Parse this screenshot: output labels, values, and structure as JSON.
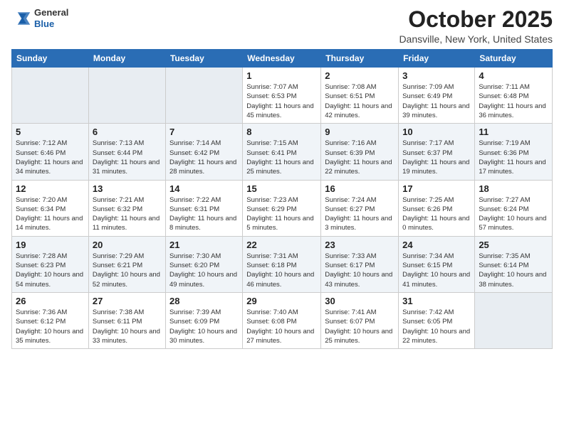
{
  "logo": {
    "general": "General",
    "blue": "Blue"
  },
  "header": {
    "title": "October 2025",
    "location": "Dansville, New York, United States"
  },
  "days_of_week": [
    "Sunday",
    "Monday",
    "Tuesday",
    "Wednesday",
    "Thursday",
    "Friday",
    "Saturday"
  ],
  "weeks": [
    [
      null,
      null,
      null,
      {
        "day": "1",
        "sunrise": "7:07 AM",
        "sunset": "6:53 PM",
        "daylight": "11 hours and 45 minutes."
      },
      {
        "day": "2",
        "sunrise": "7:08 AM",
        "sunset": "6:51 PM",
        "daylight": "11 hours and 42 minutes."
      },
      {
        "day": "3",
        "sunrise": "7:09 AM",
        "sunset": "6:49 PM",
        "daylight": "11 hours and 39 minutes."
      },
      {
        "day": "4",
        "sunrise": "7:11 AM",
        "sunset": "6:48 PM",
        "daylight": "11 hours and 36 minutes."
      }
    ],
    [
      {
        "day": "5",
        "sunrise": "7:12 AM",
        "sunset": "6:46 PM",
        "daylight": "11 hours and 34 minutes."
      },
      {
        "day": "6",
        "sunrise": "7:13 AM",
        "sunset": "6:44 PM",
        "daylight": "11 hours and 31 minutes."
      },
      {
        "day": "7",
        "sunrise": "7:14 AM",
        "sunset": "6:42 PM",
        "daylight": "11 hours and 28 minutes."
      },
      {
        "day": "8",
        "sunrise": "7:15 AM",
        "sunset": "6:41 PM",
        "daylight": "11 hours and 25 minutes."
      },
      {
        "day": "9",
        "sunrise": "7:16 AM",
        "sunset": "6:39 PM",
        "daylight": "11 hours and 22 minutes."
      },
      {
        "day": "10",
        "sunrise": "7:17 AM",
        "sunset": "6:37 PM",
        "daylight": "11 hours and 19 minutes."
      },
      {
        "day": "11",
        "sunrise": "7:19 AM",
        "sunset": "6:36 PM",
        "daylight": "11 hours and 17 minutes."
      }
    ],
    [
      {
        "day": "12",
        "sunrise": "7:20 AM",
        "sunset": "6:34 PM",
        "daylight": "11 hours and 14 minutes."
      },
      {
        "day": "13",
        "sunrise": "7:21 AM",
        "sunset": "6:32 PM",
        "daylight": "11 hours and 11 minutes."
      },
      {
        "day": "14",
        "sunrise": "7:22 AM",
        "sunset": "6:31 PM",
        "daylight": "11 hours and 8 minutes."
      },
      {
        "day": "15",
        "sunrise": "7:23 AM",
        "sunset": "6:29 PM",
        "daylight": "11 hours and 5 minutes."
      },
      {
        "day": "16",
        "sunrise": "7:24 AM",
        "sunset": "6:27 PM",
        "daylight": "11 hours and 3 minutes."
      },
      {
        "day": "17",
        "sunrise": "7:25 AM",
        "sunset": "6:26 PM",
        "daylight": "11 hours and 0 minutes."
      },
      {
        "day": "18",
        "sunrise": "7:27 AM",
        "sunset": "6:24 PM",
        "daylight": "10 hours and 57 minutes."
      }
    ],
    [
      {
        "day": "19",
        "sunrise": "7:28 AM",
        "sunset": "6:23 PM",
        "daylight": "10 hours and 54 minutes."
      },
      {
        "day": "20",
        "sunrise": "7:29 AM",
        "sunset": "6:21 PM",
        "daylight": "10 hours and 52 minutes."
      },
      {
        "day": "21",
        "sunrise": "7:30 AM",
        "sunset": "6:20 PM",
        "daylight": "10 hours and 49 minutes."
      },
      {
        "day": "22",
        "sunrise": "7:31 AM",
        "sunset": "6:18 PM",
        "daylight": "10 hours and 46 minutes."
      },
      {
        "day": "23",
        "sunrise": "7:33 AM",
        "sunset": "6:17 PM",
        "daylight": "10 hours and 43 minutes."
      },
      {
        "day": "24",
        "sunrise": "7:34 AM",
        "sunset": "6:15 PM",
        "daylight": "10 hours and 41 minutes."
      },
      {
        "day": "25",
        "sunrise": "7:35 AM",
        "sunset": "6:14 PM",
        "daylight": "10 hours and 38 minutes."
      }
    ],
    [
      {
        "day": "26",
        "sunrise": "7:36 AM",
        "sunset": "6:12 PM",
        "daylight": "10 hours and 35 minutes."
      },
      {
        "day": "27",
        "sunrise": "7:38 AM",
        "sunset": "6:11 PM",
        "daylight": "10 hours and 33 minutes."
      },
      {
        "day": "28",
        "sunrise": "7:39 AM",
        "sunset": "6:09 PM",
        "daylight": "10 hours and 30 minutes."
      },
      {
        "day": "29",
        "sunrise": "7:40 AM",
        "sunset": "6:08 PM",
        "daylight": "10 hours and 27 minutes."
      },
      {
        "day": "30",
        "sunrise": "7:41 AM",
        "sunset": "6:07 PM",
        "daylight": "10 hours and 25 minutes."
      },
      {
        "day": "31",
        "sunrise": "7:42 AM",
        "sunset": "6:05 PM",
        "daylight": "10 hours and 22 minutes."
      },
      null
    ]
  ]
}
